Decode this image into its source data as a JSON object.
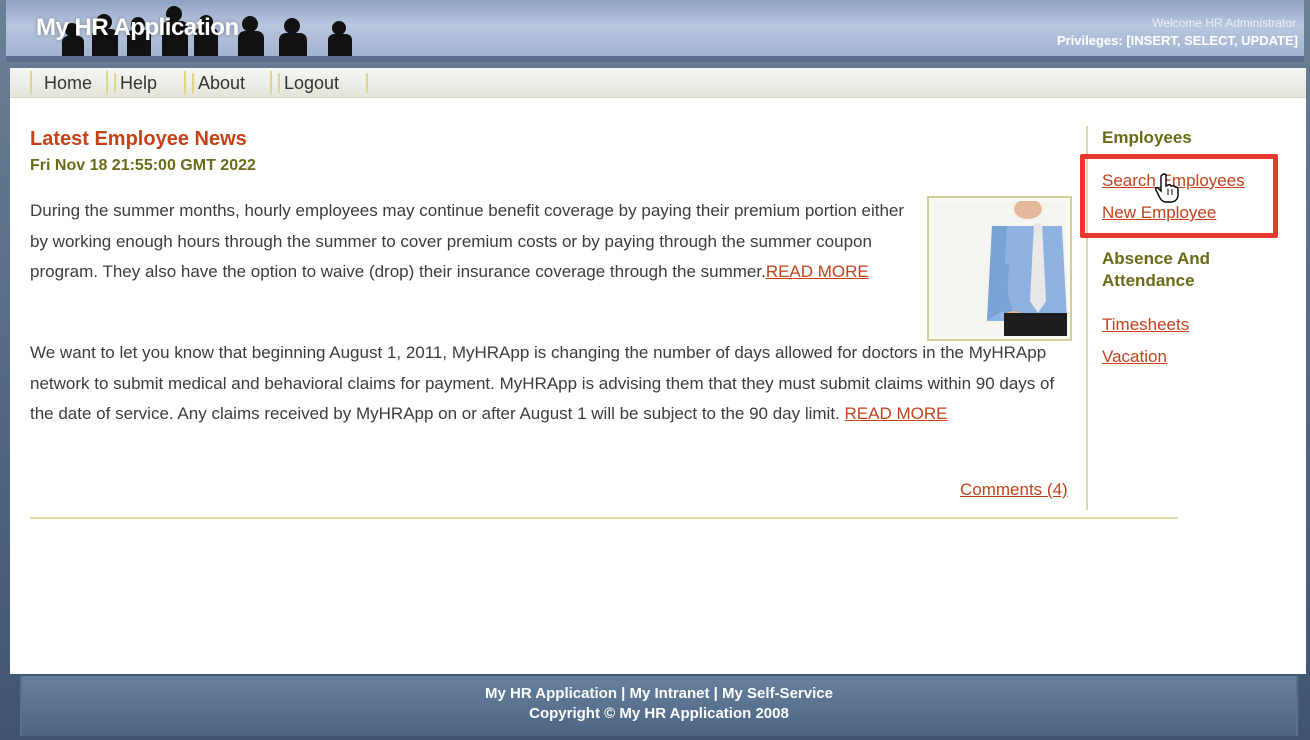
{
  "header": {
    "app_title": "My HR Application",
    "welcome": "Welcome HR Administrator",
    "privileges": "Privileges: [INSERT, SELECT, UPDATE]"
  },
  "nav": {
    "items": [
      "Home",
      "Help",
      "About",
      "Logout"
    ]
  },
  "news": {
    "title": "Latest Employee News",
    "date": "Fri Nov 18 21:55:00 GMT 2022",
    "para1": "During the summer months, hourly employees may continue benefit coverage by paying their premium portion either by working enough hours through the summer to cover premium costs or by paying through the summer coupon program. They also have the option to waive (drop) their insurance coverage through the summer.",
    "para2": "We want to let you know that beginning August 1, 2011, MyHRApp is changing the number of days allowed for doctors in the MyHRApp network to submit medical and behavioral claims for payment.  MyHRApp is advising them that they must submit claims within 90 days of the date of service.  Any claims received by MyHRApp on or after August 1 will be subject to the 90 day limit. ",
    "read_more": "READ MORE",
    "comments": "Comments (4)"
  },
  "sidebar": {
    "employees_heading": "Employees",
    "search_employees": "Search Employees",
    "new_employee": "New Employee",
    "absence_heading_line1": "Absence And",
    "absence_heading_line2": "Attendance",
    "timesheets": "Timesheets",
    "vacation": "Vacation"
  },
  "footer": {
    "links": "My HR Application | My Intranet | My Self-Service",
    "copyright": "Copyright © My HR Application 2008"
  },
  "colors": {
    "accent": "#c4421a",
    "olive": "#6b6a17",
    "highlight": "#e9392a",
    "header": "#8fa2c4"
  }
}
